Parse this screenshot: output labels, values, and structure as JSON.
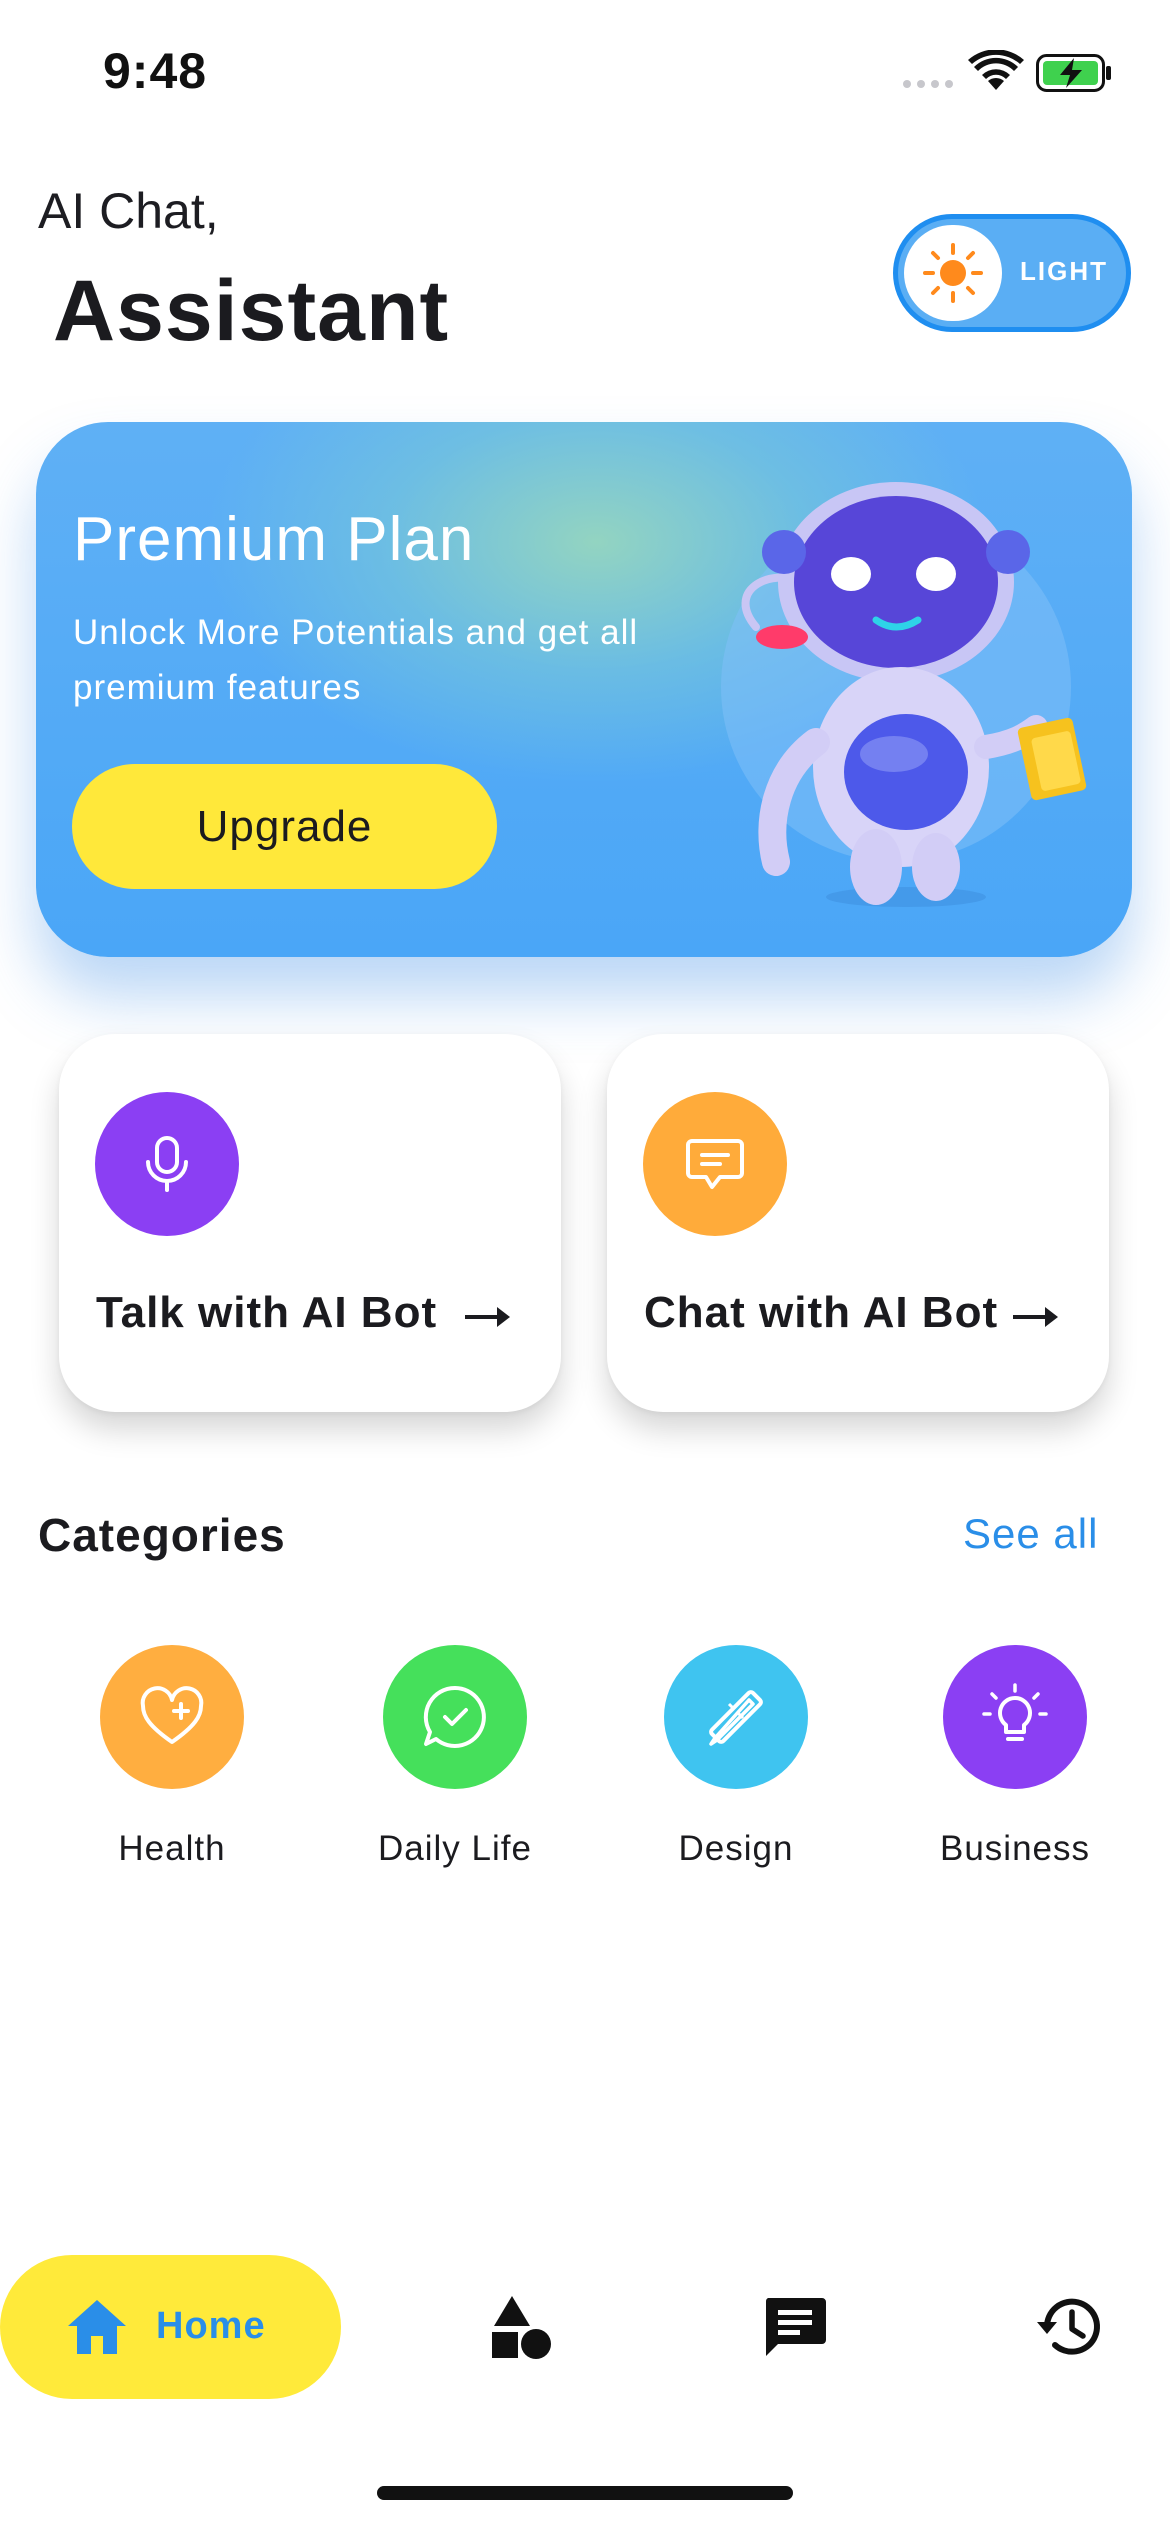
{
  "status_bar": {
    "time": "9:48"
  },
  "header": {
    "greeting": "AI Chat,",
    "title": "Assistant"
  },
  "theme_toggle": {
    "label": "LIGHT",
    "icon": "sun-icon"
  },
  "premium": {
    "title": "Premium Plan",
    "subtitle": "Unlock More Potentials and get all premium features",
    "button_label": "Upgrade"
  },
  "actions": [
    {
      "label": "Talk with AI Bot",
      "icon": "microphone-icon",
      "color": "#8b3ff3"
    },
    {
      "label": "Chat with AI Bot",
      "icon": "chat-bubble-icon",
      "color": "#ffab3a"
    }
  ],
  "categories": {
    "title": "Categories",
    "see_all": "See all",
    "items": [
      {
        "label": "Health",
        "icon": "heart-plus-icon",
        "color": "#ffae40"
      },
      {
        "label": "Daily Life",
        "icon": "chat-check-icon",
        "color": "#45e05b"
      },
      {
        "label": "Design",
        "icon": "ruler-pencil-icon",
        "color": "#3fc4f0"
      },
      {
        "label": "Business",
        "icon": "lightbulb-icon",
        "color": "#8b3ff3"
      }
    ]
  },
  "bottom_nav": {
    "items": [
      {
        "label": "Home",
        "icon": "home-icon",
        "active": true
      },
      {
        "icon": "shapes-icon"
      },
      {
        "icon": "message-icon"
      },
      {
        "icon": "history-icon"
      }
    ]
  },
  "colors": {
    "accent": "#2a8ee8",
    "highlight": "#ffea3a",
    "card_blue": "#4aa6f7"
  }
}
